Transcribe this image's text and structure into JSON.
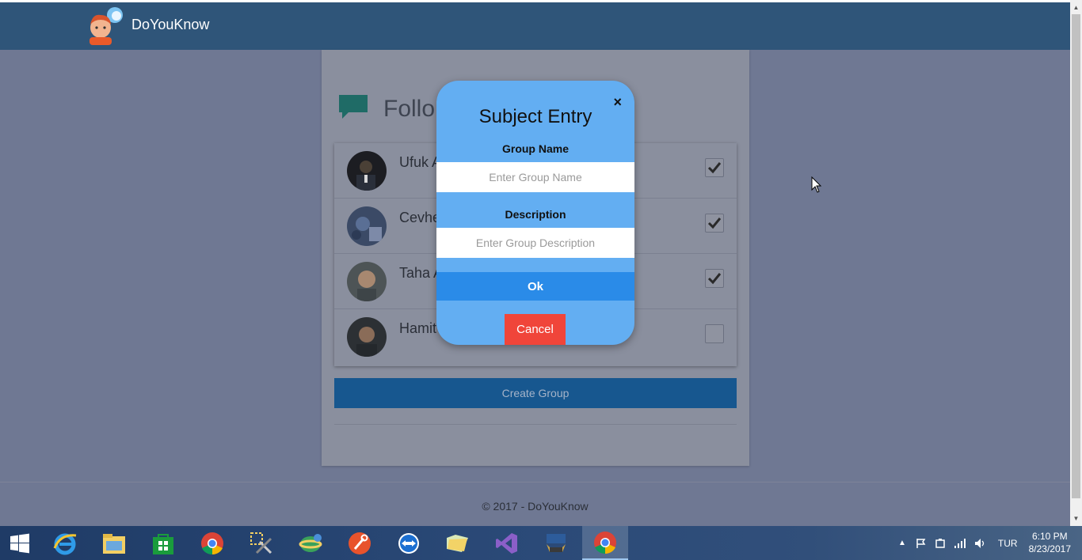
{
  "app": {
    "brand_name": "DoYouKnow"
  },
  "page": {
    "card_title": "Follo",
    "users": [
      {
        "name": "Ufuk A",
        "checked": true
      },
      {
        "name": "Cevhe",
        "checked": true
      },
      {
        "name": "Taha A",
        "checked": true
      },
      {
        "name": "Hamit",
        "checked": false
      }
    ],
    "create_group_label": "Create Group",
    "footer": "© 2017 - DoYouKnow"
  },
  "modal": {
    "title": "Subject Entry",
    "close_label": "×",
    "group_name_label": "Group Name",
    "group_name_placeholder": "Enter Group Name",
    "description_label": "Description",
    "description_placeholder": "Enter Group Description",
    "ok_label": "Ok",
    "cancel_label": "Cancel"
  },
  "taskbar": {
    "apps": [
      "windows-start-icon",
      "internet-explorer-icon",
      "file-explorer-icon",
      "store-icon",
      "chrome-icon",
      "tools-icon",
      "network-globe-icon",
      "sourcetree-icon",
      "teamviewer-icon",
      "folder-icon",
      "visual-studio-icon",
      "sql-server-icon",
      "chrome-active-icon"
    ],
    "language": "TUR",
    "time": "6:10 PM",
    "date": "8/23/2017"
  },
  "colors": {
    "navbar": "#2f5579",
    "modal_bg": "#63aef2",
    "ok_button": "#2a8be8",
    "cancel_button": "#f0453a",
    "create_group": "#17578f"
  }
}
